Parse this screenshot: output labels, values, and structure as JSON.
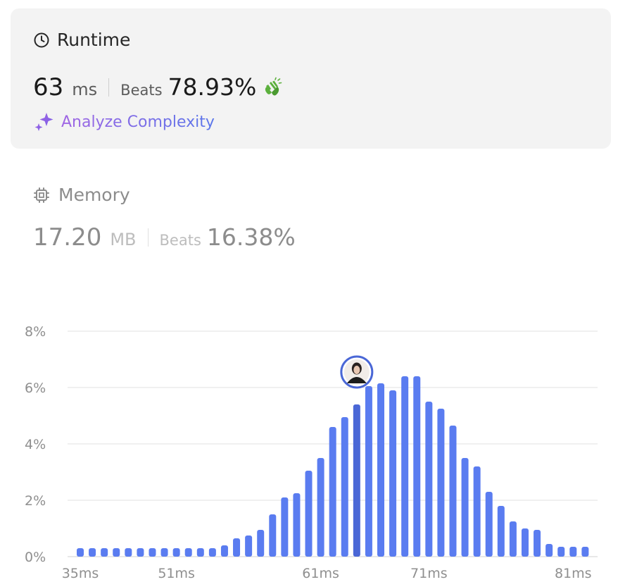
{
  "runtime": {
    "title": "Runtime",
    "value": "63",
    "unit": "ms",
    "beats_label": "Beats",
    "beats_value": "78.93%",
    "analyze_label": "Analyze Complexity"
  },
  "memory": {
    "title": "Memory",
    "value": "17.20",
    "unit": "MB",
    "beats_label": "Beats",
    "beats_value": "16.38%"
  },
  "colors": {
    "bar": "#5a7cf0",
    "bar_highlight": "#4a67d6",
    "accent_purple": "#a065e4",
    "accent_blue": "#5a76ea",
    "clap_green": "#5bb03c"
  },
  "chart_data": {
    "type": "bar",
    "x_tick_labels": [
      "35ms",
      "51ms",
      "61ms",
      "71ms",
      "81ms"
    ],
    "y_tick_labels": [
      "0%",
      "2%",
      "4%",
      "6%",
      "8%"
    ],
    "ylim": [
      0,
      8
    ],
    "grid": true,
    "highlight_index": 23,
    "values": [
      0.3,
      0.3,
      0.3,
      0.3,
      0.3,
      0.3,
      0.3,
      0.3,
      0.3,
      0.3,
      0.3,
      0.3,
      0.4,
      0.65,
      0.75,
      0.95,
      1.5,
      2.1,
      2.25,
      3.05,
      3.5,
      4.6,
      4.95,
      5.4,
      6.05,
      6.15,
      5.9,
      6.4,
      6.4,
      5.5,
      5.25,
      4.65,
      3.5,
      3.2,
      2.3,
      1.8,
      1.25,
      1.0,
      0.95,
      0.45,
      0.35,
      0.35,
      0.35
    ]
  }
}
